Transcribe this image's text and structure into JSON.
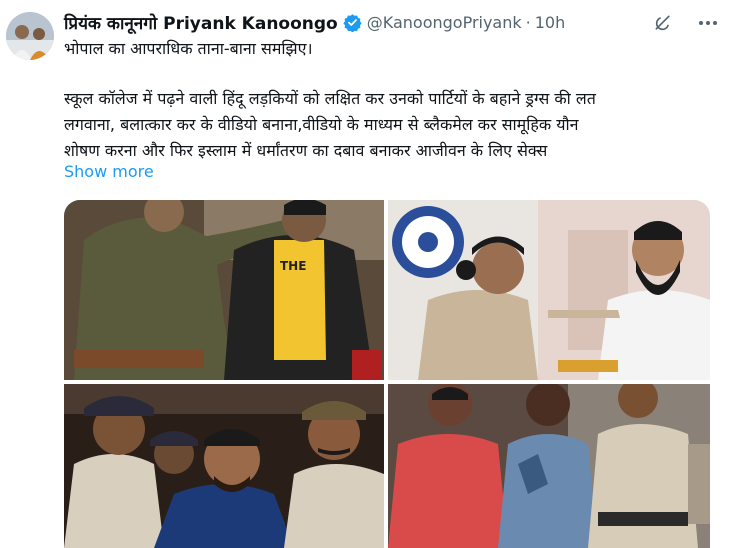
{
  "author": {
    "name": "प्रियंक कानूनगो Priyank Kanoongo",
    "handle": "@KanoongoPriyank",
    "separator": "·",
    "time": "10h"
  },
  "tweet": {
    "first_line": "भोपाल का आपराधिक ताना-बाना समझिए।",
    "paragraph_lines": [
      "स्कूल कॉलेज में पढ़ने वाली हिंदू लड़कियों को लक्षित कर उनको पार्टियों के बहाने ड्रग्स की लत",
      "लगवाना, बलात्कार कर के वीडियो बनाना,वीडियो के माध्यम से ब्लैकमेल कर सामूहिक यौन",
      "शोषण करना और फिर इस्लाम में धर्मांतरण का दबाव बनाकर आजीवन के लिए सेक्स"
    ],
    "show_more": "Show more"
  },
  "media_shirt_text": "THE",
  "icons": {
    "verified": "verified-badge-icon",
    "grok": "grok-icon",
    "more": "more-options-icon"
  },
  "colors": {
    "accent": "#1d9bf0",
    "text": "#0f1419",
    "secondary": "#536471"
  }
}
